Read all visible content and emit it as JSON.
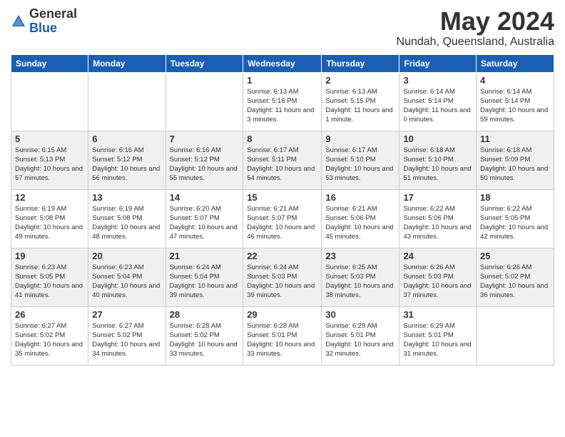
{
  "logo": {
    "general": "General",
    "blue": "Blue"
  },
  "title": "May 2024",
  "location": "Nundah, Queensland, Australia",
  "days_of_week": [
    "Sunday",
    "Monday",
    "Tuesday",
    "Wednesday",
    "Thursday",
    "Friday",
    "Saturday"
  ],
  "weeks": [
    [
      {
        "day": "",
        "info": ""
      },
      {
        "day": "",
        "info": ""
      },
      {
        "day": "",
        "info": ""
      },
      {
        "day": "1",
        "info": "Sunrise: 6:13 AM\nSunset: 5:16 PM\nDaylight: 11 hours and 3 minutes."
      },
      {
        "day": "2",
        "info": "Sunrise: 6:13 AM\nSunset: 5:15 PM\nDaylight: 11 hours and 1 minute."
      },
      {
        "day": "3",
        "info": "Sunrise: 6:14 AM\nSunset: 5:14 PM\nDaylight: 11 hours and 0 minutes."
      },
      {
        "day": "4",
        "info": "Sunrise: 6:14 AM\nSunset: 5:14 PM\nDaylight: 10 hours and 59 minutes."
      }
    ],
    [
      {
        "day": "5",
        "info": "Sunrise: 6:15 AM\nSunset: 5:13 PM\nDaylight: 10 hours and 57 minutes."
      },
      {
        "day": "6",
        "info": "Sunrise: 6:16 AM\nSunset: 5:12 PM\nDaylight: 10 hours and 56 minutes."
      },
      {
        "day": "7",
        "info": "Sunrise: 6:16 AM\nSunset: 5:12 PM\nDaylight: 10 hours and 55 minutes."
      },
      {
        "day": "8",
        "info": "Sunrise: 6:17 AM\nSunset: 5:11 PM\nDaylight: 10 hours and 54 minutes."
      },
      {
        "day": "9",
        "info": "Sunrise: 6:17 AM\nSunset: 5:10 PM\nDaylight: 10 hours and 53 minutes."
      },
      {
        "day": "10",
        "info": "Sunrise: 6:18 AM\nSunset: 5:10 PM\nDaylight: 10 hours and 51 minutes."
      },
      {
        "day": "11",
        "info": "Sunrise: 6:18 AM\nSunset: 5:09 PM\nDaylight: 10 hours and 50 minutes."
      }
    ],
    [
      {
        "day": "12",
        "info": "Sunrise: 6:19 AM\nSunset: 5:08 PM\nDaylight: 10 hours and 49 minutes."
      },
      {
        "day": "13",
        "info": "Sunrise: 6:19 AM\nSunset: 5:08 PM\nDaylight: 10 hours and 48 minutes."
      },
      {
        "day": "14",
        "info": "Sunrise: 6:20 AM\nSunset: 5:07 PM\nDaylight: 10 hours and 47 minutes."
      },
      {
        "day": "15",
        "info": "Sunrise: 6:21 AM\nSunset: 5:07 PM\nDaylight: 10 hours and 46 minutes."
      },
      {
        "day": "16",
        "info": "Sunrise: 6:21 AM\nSunset: 5:06 PM\nDaylight: 10 hours and 45 minutes."
      },
      {
        "day": "17",
        "info": "Sunrise: 6:22 AM\nSunset: 5:06 PM\nDaylight: 10 hours and 43 minutes."
      },
      {
        "day": "18",
        "info": "Sunrise: 6:22 AM\nSunset: 5:05 PM\nDaylight: 10 hours and 42 minutes."
      }
    ],
    [
      {
        "day": "19",
        "info": "Sunrise: 6:23 AM\nSunset: 5:05 PM\nDaylight: 10 hours and 41 minutes."
      },
      {
        "day": "20",
        "info": "Sunrise: 6:23 AM\nSunset: 5:04 PM\nDaylight: 10 hours and 40 minutes."
      },
      {
        "day": "21",
        "info": "Sunrise: 6:24 AM\nSunset: 5:04 PM\nDaylight: 10 hours and 39 minutes."
      },
      {
        "day": "22",
        "info": "Sunrise: 6:24 AM\nSunset: 5:03 PM\nDaylight: 10 hours and 39 minutes."
      },
      {
        "day": "23",
        "info": "Sunrise: 6:25 AM\nSunset: 5:03 PM\nDaylight: 10 hours and 38 minutes."
      },
      {
        "day": "24",
        "info": "Sunrise: 6:26 AM\nSunset: 5:03 PM\nDaylight: 10 hours and 37 minutes."
      },
      {
        "day": "25",
        "info": "Sunrise: 6:26 AM\nSunset: 5:02 PM\nDaylight: 10 hours and 36 minutes."
      }
    ],
    [
      {
        "day": "26",
        "info": "Sunrise: 6:27 AM\nSunset: 5:02 PM\nDaylight: 10 hours and 35 minutes."
      },
      {
        "day": "27",
        "info": "Sunrise: 6:27 AM\nSunset: 5:02 PM\nDaylight: 10 hours and 34 minutes."
      },
      {
        "day": "28",
        "info": "Sunrise: 6:28 AM\nSunset: 5:02 PM\nDaylight: 10 hours and 33 minutes."
      },
      {
        "day": "29",
        "info": "Sunrise: 6:28 AM\nSunset: 5:01 PM\nDaylight: 10 hours and 33 minutes."
      },
      {
        "day": "30",
        "info": "Sunrise: 6:29 AM\nSunset: 5:01 PM\nDaylight: 10 hours and 32 minutes."
      },
      {
        "day": "31",
        "info": "Sunrise: 6:29 AM\nSunset: 5:01 PM\nDaylight: 10 hours and 31 minutes."
      },
      {
        "day": "",
        "info": ""
      }
    ]
  ],
  "row_shading": [
    false,
    true,
    false,
    true,
    false
  ]
}
